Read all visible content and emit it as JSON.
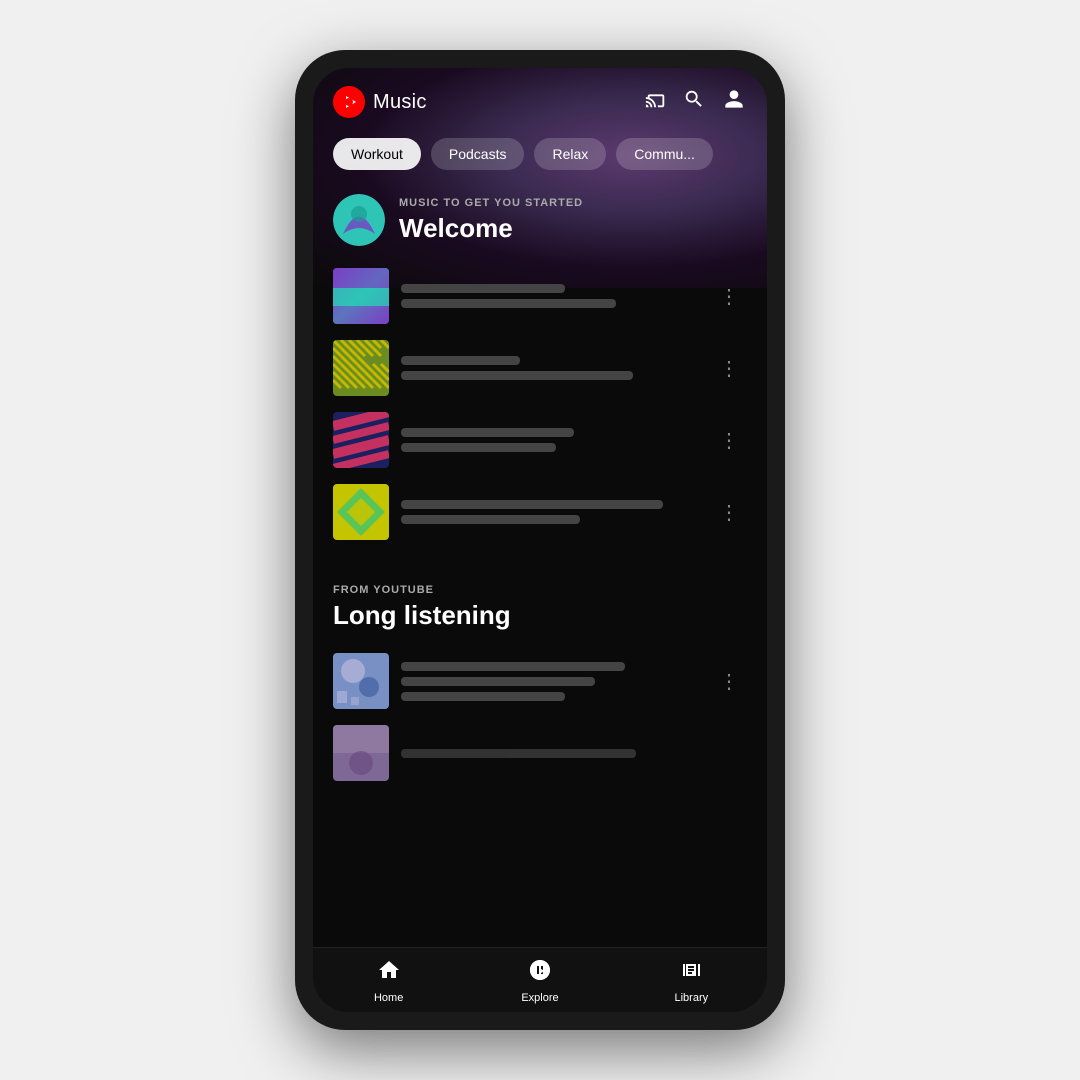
{
  "app": {
    "name": "Music",
    "logo_label": "Music"
  },
  "header": {
    "cast_icon": "cast",
    "search_icon": "search",
    "account_icon": "account"
  },
  "tabs": [
    {
      "id": "workout",
      "label": "Workout",
      "active": true
    },
    {
      "id": "podcasts",
      "label": "Podcasts",
      "active": false
    },
    {
      "id": "relax",
      "label": "Relax",
      "active": false
    },
    {
      "id": "community",
      "label": "Commu...",
      "active": false
    }
  ],
  "section1": {
    "label": "MUSIC TO GET YOU STARTED",
    "title": "Welcome",
    "tracks": [
      {
        "id": 1,
        "line1_width": "55%",
        "line2_width": "72%",
        "art_class": "art-1"
      },
      {
        "id": 2,
        "line1_width": "40%",
        "line2_width": "80%",
        "art_class": "art-2"
      },
      {
        "id": 3,
        "line1_width": "60%",
        "line2_width": "55%",
        "art_class": "art-3"
      },
      {
        "id": 4,
        "line1_width": "88%",
        "line2_width": "62%",
        "art_class": "art-4"
      }
    ]
  },
  "section2": {
    "label": "FROM YOUTUBE",
    "title": "Long listening",
    "tracks": [
      {
        "id": 5,
        "line1_width": "75%",
        "line2_width": "65%",
        "line3_width": "55%",
        "art_class": "art-5"
      },
      {
        "id": 6,
        "line1_width": "70%",
        "art_class": "art-6"
      }
    ]
  },
  "bottom_nav": [
    {
      "id": "home",
      "label": "Home",
      "icon": "home"
    },
    {
      "id": "explore",
      "label": "Explore",
      "icon": "explore"
    },
    {
      "id": "library",
      "label": "Library",
      "icon": "library"
    }
  ]
}
